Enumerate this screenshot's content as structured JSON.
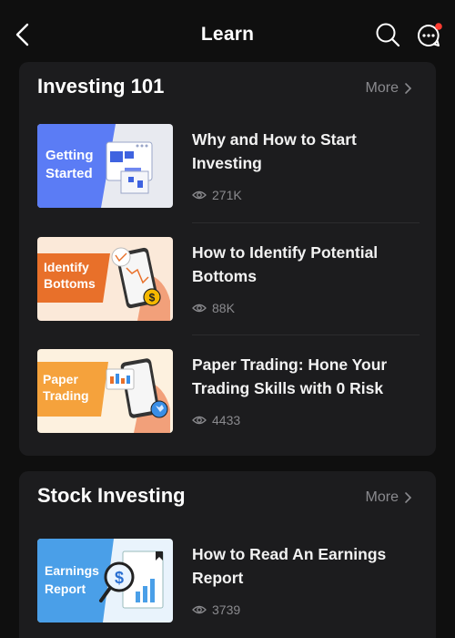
{
  "header": {
    "title": "Learn"
  },
  "sections": [
    {
      "title": "Investing 101",
      "more": "More",
      "items": [
        {
          "thumb_label": "Getting\nStarted",
          "title": "Why and How to Start Investing",
          "views": "271K"
        },
        {
          "thumb_label": "Identify\nBottoms",
          "title": "How to Identify Potential Bottoms",
          "views": "88K"
        },
        {
          "thumb_label": "Paper\nTrading",
          "title": "Paper Trading: Hone Your Trading Skills with 0 Risk",
          "views": "4433"
        }
      ]
    },
    {
      "title": "Stock Investing",
      "more": "More",
      "items": [
        {
          "thumb_label": "Earnings\nReport",
          "title": "How to Read An Earnings Report",
          "views": "3739"
        }
      ]
    }
  ],
  "colors": {
    "background": "#0f0f0f",
    "card": "#1c1c1e",
    "muted_text": "#8a8a8e",
    "notification_dot": "#ff3b30",
    "thumb_blue": "#5b7cf5",
    "thumb_orange": "#e8702a",
    "thumb_amber": "#f5a23c",
    "thumb_sky": "#4a9fe8"
  },
  "icons": [
    "back-arrow-icon",
    "search-icon",
    "chat-icon",
    "chevron-right-icon",
    "eye-icon"
  ]
}
